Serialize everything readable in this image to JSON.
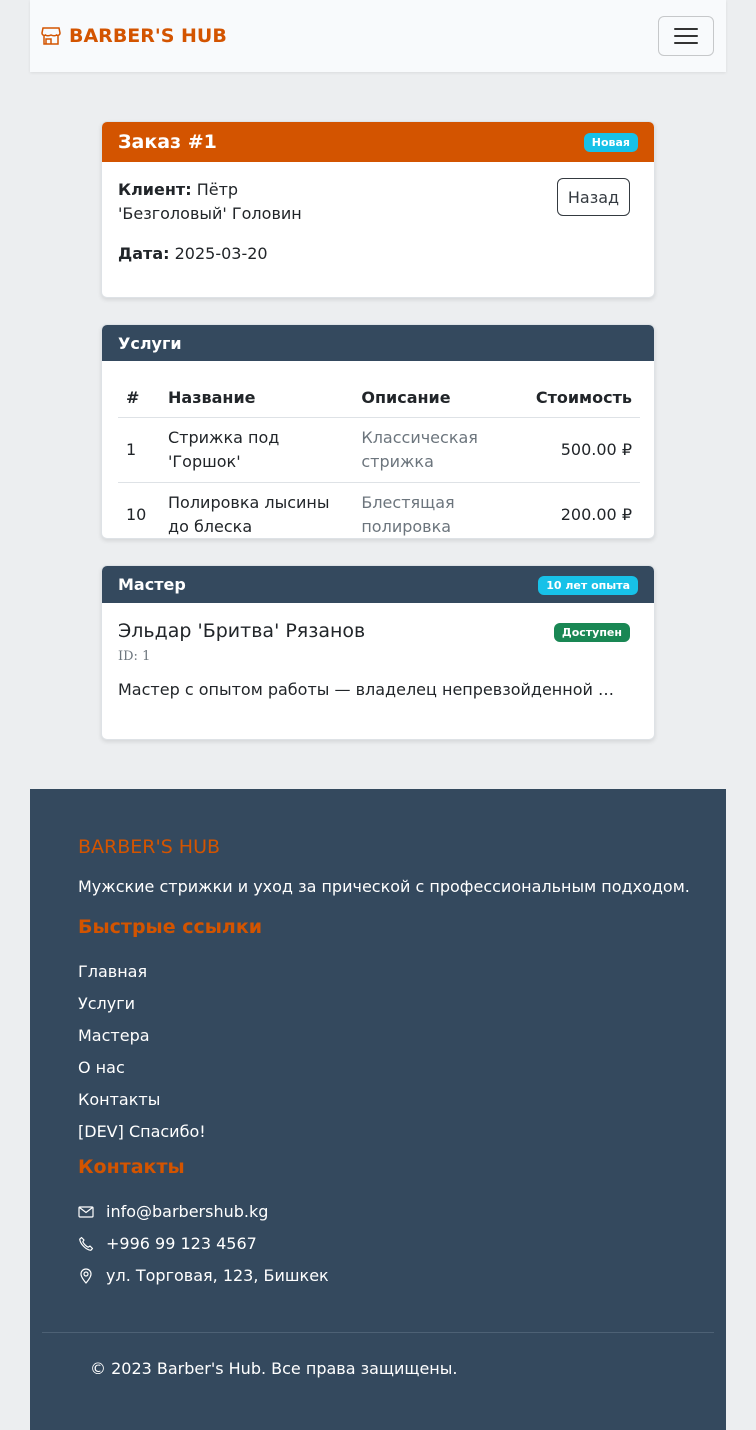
{
  "navbar": {
    "brand": "BARBER'S HUB",
    "brand_icon": "shop-icon",
    "menu_icon": "hamburger-menu-icon",
    "accent_color": "#d35400"
  },
  "order": {
    "title": "Заказ #1",
    "status_badge": "Новая",
    "client_label": "Клиент:",
    "client_value": "Пётр 'Безголовый' Головин",
    "date_label": "Дата:",
    "date_value": "2025-03-20",
    "back_button": "Назад"
  },
  "services": {
    "title": "Услуги",
    "columns": [
      "#",
      "Название",
      "Описание",
      "Стоимость"
    ],
    "rows": [
      {
        "id": "1",
        "name": "Стрижка под 'Горшок'",
        "description": "Классическая стрижка",
        "price": "500.00 ₽"
      },
      {
        "id": "10",
        "name": "Полировка лысины до блеска",
        "description": "Блестящая полировка",
        "price": "200.00 ₽"
      }
    ]
  },
  "master": {
    "header": "Мастер",
    "experience_badge": "10 лет опыта",
    "name": "Эльдар 'Бритва' Рязанов",
    "availability": "Доступен",
    "id_text": "ID: 1",
    "description": "Мастер с опытом работы — владелец непревзойденной техники"
  },
  "footer": {
    "brand": "BARBER'S HUB",
    "about": "Мужские стрижки и уход за прической с профессиональным подходом.",
    "links_title": "Быстрые ссылки",
    "links": [
      "Главная",
      "Услуги",
      "Мастера",
      "О нас",
      "Контакты",
      "[DEV] Спасибо!"
    ],
    "contacts_title": "Контакты",
    "contacts": [
      {
        "icon": "envelope-icon",
        "text": "info@barbershub.kg"
      },
      {
        "icon": "phone-icon",
        "text": "+996 99 123 4567"
      },
      {
        "icon": "location-pin-icon",
        "text": "ул. Торговая, 123, Бишкек"
      }
    ],
    "copyright": "© 2023 Barber's Hub. Все права защищены.",
    "bg_color": "#34495e"
  }
}
